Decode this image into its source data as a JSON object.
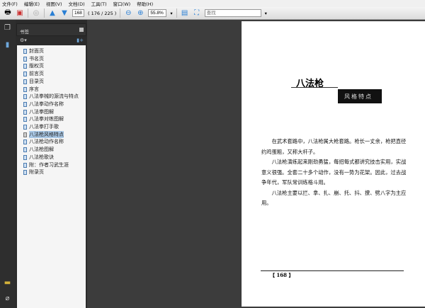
{
  "menu": [
    "文件(F)",
    "编辑(E)",
    "视图(V)",
    "文档(D)",
    "工具(T)",
    "窗口(W)",
    "帮助(H)"
  ],
  "toolbar": {
    "page_input": "168",
    "page_count": "( 176 / 225 )",
    "zoom": "55.8%",
    "find_placeholder": "查找"
  },
  "panel": {
    "title": "书签"
  },
  "bookmarks": [
    "封面页",
    "书名页",
    "版权页",
    "前言页",
    "目录页",
    "序言",
    "八法拳械的源流与特点",
    "八法拳动作名称",
    "八法拳图解",
    "八法拳对练图解",
    "八法拳打手歌",
    "八法枪风格特点",
    "八法枪动作名称",
    "八法枪图解",
    "八法枪歌诀",
    "附：作者习武生涯",
    "附录页"
  ],
  "selected_bookmark": 11,
  "page": {
    "title": "八法枪",
    "subtitle": "风格特点",
    "paragraphs": [
      "在武术套路中，八法枪属大枪套路。枪长一丈余，枪把直径约鸡蛋粗，又称大杆子。",
      "八法枪演练起来刚劲勇猛，每招每式都讲究技击实用，实战意义很强。全套二十多个动作，没有一势为花架。因此，过去战争年代，军队常训练格斗用。",
      "八法枪主要以拦、拿、扎、崩、托、抖、撩、劈八字为主应用。"
    ],
    "page_number": "【 168 】"
  }
}
